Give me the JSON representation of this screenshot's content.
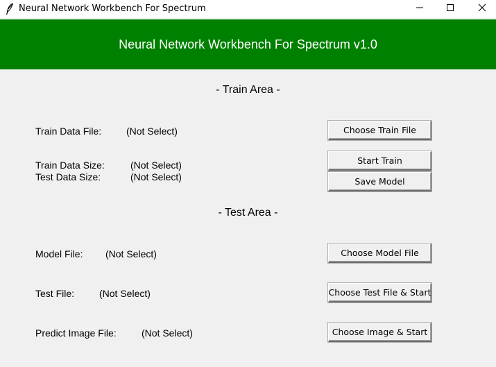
{
  "window": {
    "title": "Neural Network Workbench For Spectrum",
    "controls": {
      "minimize_icon": "minimize-icon",
      "maximize_icon": "maximize-icon",
      "close_icon": "close-icon"
    }
  },
  "header": {
    "title": "Neural Network Workbench For Spectrum v1.0",
    "background_color": "#008000",
    "text_color": "#ffffff"
  },
  "train_area": {
    "title": "- Train Area -",
    "train_data_file": {
      "label": "Train Data File:",
      "value": "(Not Select)"
    },
    "train_data_size": {
      "label": "Train Data Size:",
      "value": "(Not Select)"
    },
    "test_data_size": {
      "label": "Test Data Size:",
      "value": "(Not Select)"
    },
    "buttons": {
      "choose_train_file": "Choose Train File",
      "start_train": "Start Train",
      "save_model": "Save Model"
    }
  },
  "test_area": {
    "title": "- Test Area -",
    "model_file": {
      "label": "Model File:",
      "value": "(Not Select)"
    },
    "test_file": {
      "label": "Test File:",
      "value": "(Not Select)"
    },
    "predict_image_file": {
      "label": "Predict Image File:",
      "value": "(Not Select)"
    },
    "buttons": {
      "choose_model_file": "Choose Model File",
      "choose_test_file_start": "Choose Test File & Start",
      "choose_image_start": "Choose Image & Start"
    }
  }
}
